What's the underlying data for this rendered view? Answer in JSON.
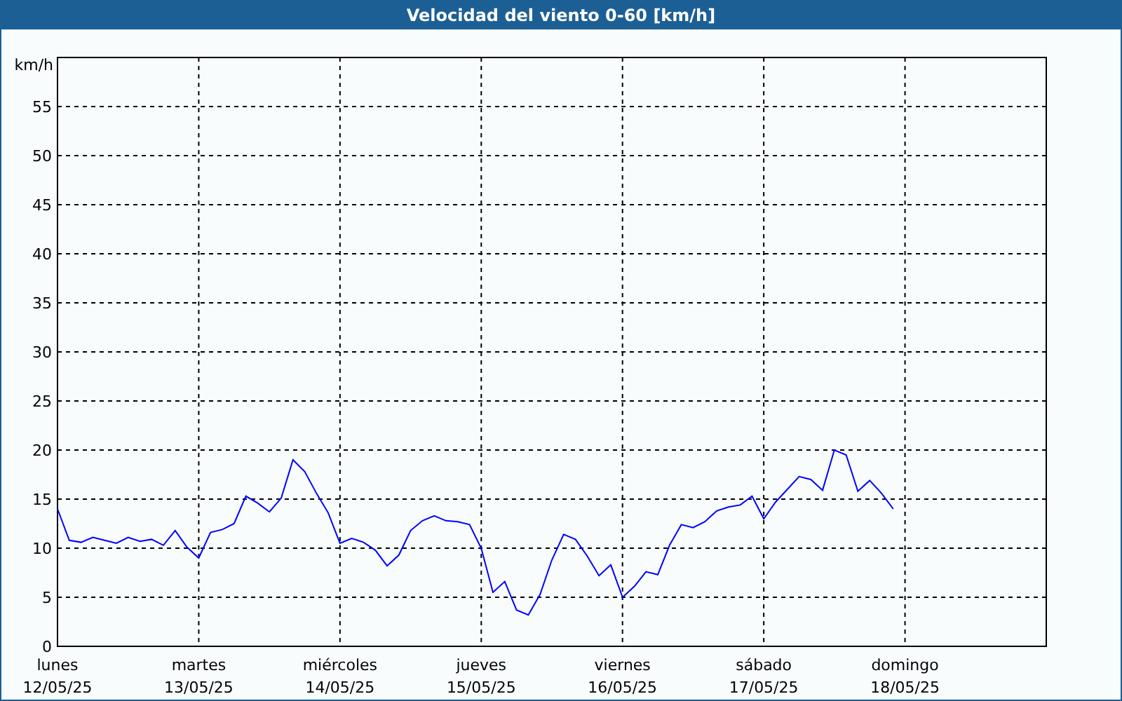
{
  "chart_data": {
    "type": "line",
    "grid": true,
    "title": "Velocidad del viento 0-60 [km/h]",
    "ylabel": "km/h",
    "ylim": [
      0,
      60
    ],
    "yticks": [
      0,
      5,
      10,
      15,
      20,
      25,
      30,
      35,
      40,
      45,
      50,
      55
    ],
    "categories": [
      "lunes\n12/05/25",
      null,
      null,
      null,
      null,
      null,
      null,
      null,
      null,
      null,
      null,
      null,
      "martes\n13/05/25",
      null,
      null,
      null,
      null,
      null,
      null,
      null,
      null,
      null,
      null,
      null,
      "miércoles\n14/05/25",
      null,
      null,
      null,
      null,
      null,
      null,
      null,
      null,
      null,
      null,
      null,
      "jueves\n15/05/25",
      null,
      null,
      null,
      null,
      null,
      null,
      null,
      null,
      null,
      null,
      null,
      "viernes\n16/05/25",
      null,
      null,
      null,
      null,
      null,
      null,
      null,
      null,
      null,
      null,
      null,
      "sábado\n17/05/25",
      null,
      null,
      null,
      null,
      null,
      null,
      null,
      null,
      null,
      null,
      null,
      "domingo\n18/05/25",
      null,
      null,
      null,
      null,
      null,
      null,
      null,
      null,
      null,
      null,
      null
    ],
    "series": [
      {
        "color": "#0000ff",
        "values": [
          14,
          10.8,
          10.6,
          11.1,
          10.8,
          10.5,
          11.1,
          10.7,
          10.9,
          10.3,
          11.8,
          10.1,
          9,
          11.6,
          11.9,
          12.5,
          15.3,
          14.6,
          13.7,
          15.1,
          19,
          17.8,
          15.6,
          13.6,
          10.5,
          11,
          10.6,
          9.8,
          8.2,
          9.3,
          11.8,
          12.8,
          13.3,
          12.8,
          12.7,
          12.4,
          10,
          5.5,
          6.6,
          3.7,
          3.2,
          5.3,
          8.8,
          11.4,
          10.9,
          9.2,
          7.2,
          8.3,
          5,
          6.1,
          7.6,
          7.3,
          10.3,
          12.4,
          12.1,
          12.7,
          13.8,
          14.2,
          14.4,
          15.3,
          13,
          14.7,
          16,
          17.3,
          17,
          15.9,
          20,
          19.5,
          15.8,
          16.9,
          15.6,
          14,
          null,
          null,
          null,
          null,
          null,
          null,
          null,
          null,
          null,
          null,
          null,
          null
        ]
      }
    ]
  }
}
